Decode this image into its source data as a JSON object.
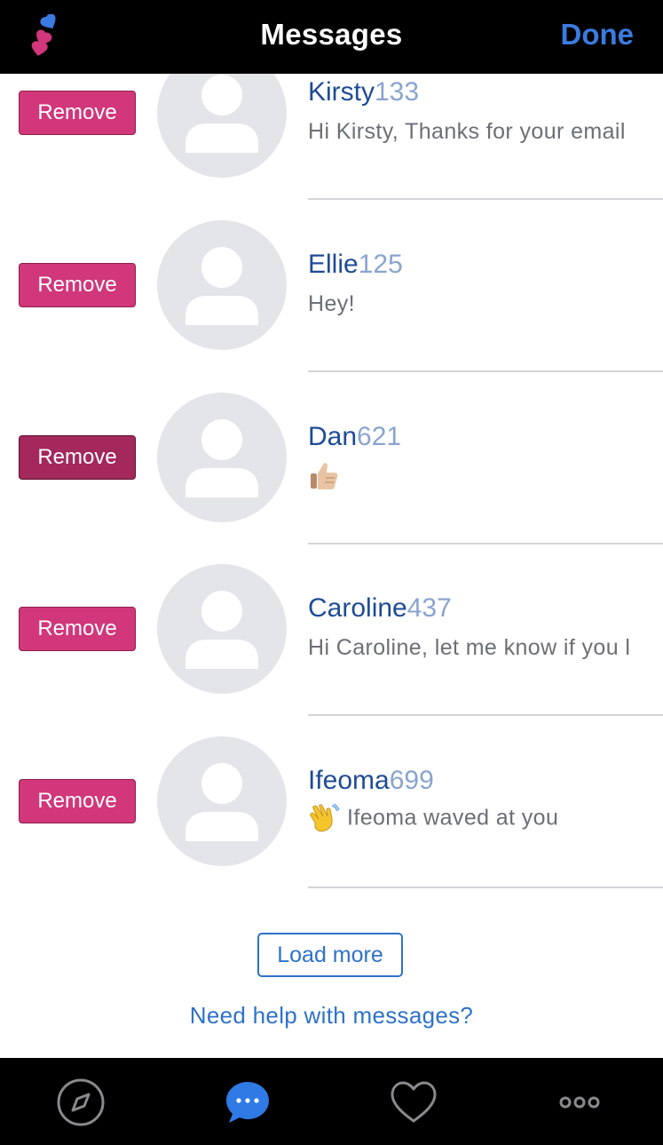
{
  "header": {
    "title": "Messages",
    "done_label": "Done",
    "logo_icon": "app-hearts-logo-icon"
  },
  "conversations": [
    {
      "name": "Kirsty",
      "number": "133",
      "preview": "Hi Kirsty, Thanks for your email",
      "emoji": "",
      "remove_label": "Remove"
    },
    {
      "name": "Ellie",
      "number": "125",
      "preview": "Hey!",
      "emoji": "",
      "remove_label": "Remove"
    },
    {
      "name": "Dan",
      "number": "621",
      "preview": "",
      "emoji": "thumbs-up-emoji",
      "remove_label": "Remove"
    },
    {
      "name": "Caroline",
      "number": "437",
      "preview": "Hi Caroline, let me know if you l",
      "emoji": "",
      "remove_label": "Remove"
    },
    {
      "name": "Ifeoma",
      "number": "699",
      "preview": "Ifeoma waved at you",
      "emoji": "waving-hand-emoji",
      "remove_label": "Remove"
    }
  ],
  "load_more_label": "Load more",
  "help_link": "Need help with messages?",
  "tabbar": {
    "items": [
      {
        "icon": "compass-icon",
        "active": false
      },
      {
        "icon": "chat-bubble-icon",
        "active": true
      },
      {
        "icon": "heart-icon",
        "active": false
      },
      {
        "icon": "more-icon",
        "active": false
      }
    ]
  },
  "colors": {
    "accent": "#3b7be0",
    "remove_button": "#d1377a",
    "name": "#1f4b96",
    "number": "#8aa4cf"
  }
}
